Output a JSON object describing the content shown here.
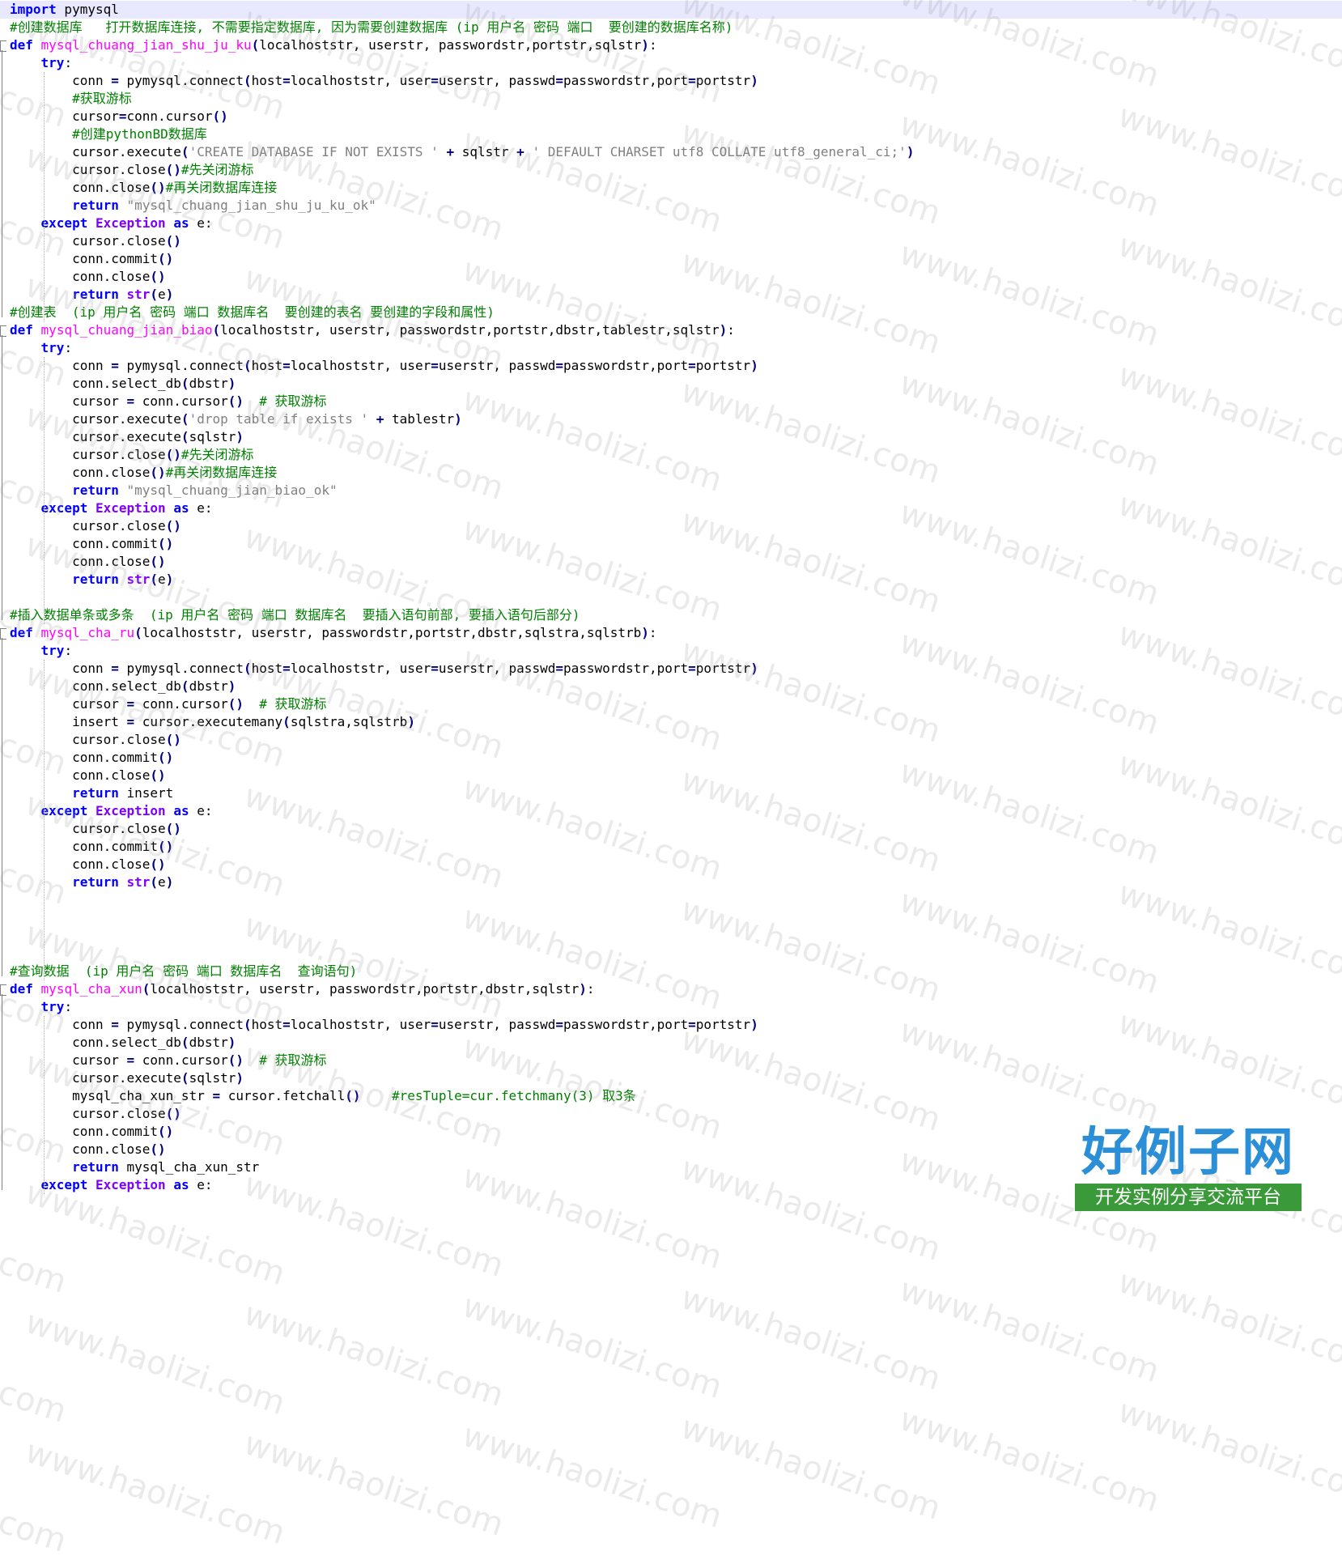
{
  "editor": {
    "lines": [
      [
        [
          "kw",
          "import"
        ],
        [
          "id",
          " pymysql"
        ]
      ],
      [
        [
          "cm",
          "#创建数据库   打开数据库连接, 不需要指定数据库, 因为需要创建数据库 (ip 用户名 密码 端口  要创建的数据库名称)"
        ]
      ],
      [
        [
          "kw",
          "def"
        ],
        [
          "id",
          " "
        ],
        [
          "fn",
          "mysql_chuang_jian_shu_ju_ku"
        ],
        [
          "op",
          "("
        ],
        [
          "id",
          "localhoststr, userstr, passwordstr,portstr,sqlstr"
        ],
        [
          "op",
          ")"
        ],
        [
          "id",
          ":"
        ]
      ],
      [
        [
          "id",
          "    "
        ],
        [
          "kw",
          "try"
        ],
        [
          "id",
          ":"
        ]
      ],
      [
        [
          "id",
          "        conn "
        ],
        [
          "op",
          "="
        ],
        [
          "id",
          " pymysql.connect"
        ],
        [
          "op",
          "("
        ],
        [
          "id",
          "host"
        ],
        [
          "op",
          "="
        ],
        [
          "id",
          "localhoststr, user"
        ],
        [
          "op",
          "="
        ],
        [
          "id",
          "userstr, passwd"
        ],
        [
          "op",
          "="
        ],
        [
          "id",
          "passwordstr,port"
        ],
        [
          "op",
          "="
        ],
        [
          "id",
          "portstr"
        ],
        [
          "op",
          ")"
        ]
      ],
      [
        [
          "id",
          "        "
        ],
        [
          "cm",
          "#获取游标"
        ]
      ],
      [
        [
          "id",
          "        cursor"
        ],
        [
          "op",
          "="
        ],
        [
          "id",
          "conn.cursor"
        ],
        [
          "op",
          "()"
        ]
      ],
      [
        [
          "id",
          "        "
        ],
        [
          "cm",
          "#创建pythonBD数据库"
        ]
      ],
      [
        [
          "id",
          "        cursor.execute"
        ],
        [
          "op",
          "("
        ],
        [
          "st",
          "'CREATE DATABASE IF NOT EXISTS '"
        ],
        [
          "id",
          " "
        ],
        [
          "op",
          "+"
        ],
        [
          "id",
          " sqlstr "
        ],
        [
          "op",
          "+"
        ],
        [
          "id",
          " "
        ],
        [
          "st",
          "' DEFAULT CHARSET utf8 COLLATE utf8_general_ci;'"
        ],
        [
          "op",
          ")"
        ]
      ],
      [
        [
          "id",
          "        cursor.close"
        ],
        [
          "op",
          "()"
        ],
        [
          "cm",
          "#先关闭游标"
        ]
      ],
      [
        [
          "id",
          "        conn.close"
        ],
        [
          "op",
          "()"
        ],
        [
          "cm",
          "#再关闭数据库连接"
        ]
      ],
      [
        [
          "id",
          "        "
        ],
        [
          "kw",
          "return"
        ],
        [
          "id",
          " "
        ],
        [
          "st",
          "\"mysql_chuang_jian_shu_ju_ku_ok\""
        ]
      ],
      [
        [
          "id",
          "    "
        ],
        [
          "kw",
          "except"
        ],
        [
          "id",
          " "
        ],
        [
          "cls",
          "Exception"
        ],
        [
          "id",
          " "
        ],
        [
          "kw",
          "as"
        ],
        [
          "id",
          " e:"
        ]
      ],
      [
        [
          "id",
          "        cursor.close"
        ],
        [
          "op",
          "()"
        ]
      ],
      [
        [
          "id",
          "        conn.commit"
        ],
        [
          "op",
          "()"
        ]
      ],
      [
        [
          "id",
          "        conn.close"
        ],
        [
          "op",
          "()"
        ]
      ],
      [
        [
          "id",
          "        "
        ],
        [
          "kw",
          "return"
        ],
        [
          "id",
          " "
        ],
        [
          "cls",
          "str"
        ],
        [
          "op",
          "("
        ],
        [
          "id",
          "e"
        ],
        [
          "op",
          ")"
        ]
      ],
      [
        [
          "cm",
          "#创建表  (ip 用户名 密码 端口 数据库名  要创建的表名 要创建的字段和属性)"
        ]
      ],
      [
        [
          "kw",
          "def"
        ],
        [
          "id",
          " "
        ],
        [
          "fn",
          "mysql_chuang_jian_biao"
        ],
        [
          "op",
          "("
        ],
        [
          "id",
          "localhoststr, userstr, passwordstr,portstr,dbstr,tablestr,sqlstr"
        ],
        [
          "op",
          ")"
        ],
        [
          "id",
          ":"
        ]
      ],
      [
        [
          "id",
          "    "
        ],
        [
          "kw",
          "try"
        ],
        [
          "id",
          ":"
        ]
      ],
      [
        [
          "id",
          "        conn "
        ],
        [
          "op",
          "="
        ],
        [
          "id",
          " pymysql.connect"
        ],
        [
          "op",
          "("
        ],
        [
          "id",
          "host"
        ],
        [
          "op",
          "="
        ],
        [
          "id",
          "localhoststr, user"
        ],
        [
          "op",
          "="
        ],
        [
          "id",
          "userstr, passwd"
        ],
        [
          "op",
          "="
        ],
        [
          "id",
          "passwordstr,port"
        ],
        [
          "op",
          "="
        ],
        [
          "id",
          "portstr"
        ],
        [
          "op",
          ")"
        ]
      ],
      [
        [
          "id",
          "        conn.select_db"
        ],
        [
          "op",
          "("
        ],
        [
          "id",
          "dbstr"
        ],
        [
          "op",
          ")"
        ]
      ],
      [
        [
          "id",
          "        cursor "
        ],
        [
          "op",
          "="
        ],
        [
          "id",
          " conn.cursor"
        ],
        [
          "op",
          "()"
        ],
        [
          "id",
          "  "
        ],
        [
          "cm",
          "# 获取游标"
        ]
      ],
      [
        [
          "id",
          "        cursor.execute"
        ],
        [
          "op",
          "("
        ],
        [
          "st",
          "'drop table if exists '"
        ],
        [
          "id",
          " "
        ],
        [
          "op",
          "+"
        ],
        [
          "id",
          " tablestr"
        ],
        [
          "op",
          ")"
        ]
      ],
      [
        [
          "id",
          "        cursor.execute"
        ],
        [
          "op",
          "("
        ],
        [
          "id",
          "sqlstr"
        ],
        [
          "op",
          ")"
        ]
      ],
      [
        [
          "id",
          "        cursor.close"
        ],
        [
          "op",
          "()"
        ],
        [
          "cm",
          "#先关闭游标"
        ]
      ],
      [
        [
          "id",
          "        conn.close"
        ],
        [
          "op",
          "()"
        ],
        [
          "cm",
          "#再关闭数据库连接"
        ]
      ],
      [
        [
          "id",
          "        "
        ],
        [
          "kw",
          "return"
        ],
        [
          "id",
          " "
        ],
        [
          "st",
          "\"mysql_chuang_jian_biao_ok\""
        ]
      ],
      [
        [
          "id",
          "    "
        ],
        [
          "kw",
          "except"
        ],
        [
          "id",
          " "
        ],
        [
          "cls",
          "Exception"
        ],
        [
          "id",
          " "
        ],
        [
          "kw",
          "as"
        ],
        [
          "id",
          " e:"
        ]
      ],
      [
        [
          "id",
          "        cursor.close"
        ],
        [
          "op",
          "()"
        ]
      ],
      [
        [
          "id",
          "        conn.commit"
        ],
        [
          "op",
          "()"
        ]
      ],
      [
        [
          "id",
          "        conn.close"
        ],
        [
          "op",
          "()"
        ]
      ],
      [
        [
          "id",
          "        "
        ],
        [
          "kw",
          "return"
        ],
        [
          "id",
          " "
        ],
        [
          "cls",
          "str"
        ],
        [
          "op",
          "("
        ],
        [
          "id",
          "e"
        ],
        [
          "op",
          ")"
        ]
      ],
      [],
      [
        [
          "cm",
          "#插入数据单条或多条  (ip 用户名 密码 端口 数据库名  要插入语句前部, 要插入语句后部分)"
        ]
      ],
      [
        [
          "kw",
          "def"
        ],
        [
          "id",
          " "
        ],
        [
          "fn",
          "mysql_cha_ru"
        ],
        [
          "op",
          "("
        ],
        [
          "id",
          "localhoststr, userstr, passwordstr,portstr,dbstr,sqlstra,sqlstrb"
        ],
        [
          "op",
          ")"
        ],
        [
          "id",
          ":"
        ]
      ],
      [
        [
          "id",
          "    "
        ],
        [
          "kw",
          "try"
        ],
        [
          "id",
          ":"
        ]
      ],
      [
        [
          "id",
          "        conn "
        ],
        [
          "op",
          "="
        ],
        [
          "id",
          " pymysql.connect"
        ],
        [
          "op",
          "("
        ],
        [
          "id",
          "host"
        ],
        [
          "op",
          "="
        ],
        [
          "id",
          "localhoststr, user"
        ],
        [
          "op",
          "="
        ],
        [
          "id",
          "userstr, passwd"
        ],
        [
          "op",
          "="
        ],
        [
          "id",
          "passwordstr,port"
        ],
        [
          "op",
          "="
        ],
        [
          "id",
          "portstr"
        ],
        [
          "op",
          ")"
        ]
      ],
      [
        [
          "id",
          "        conn.select_db"
        ],
        [
          "op",
          "("
        ],
        [
          "id",
          "dbstr"
        ],
        [
          "op",
          ")"
        ]
      ],
      [
        [
          "id",
          "        cursor "
        ],
        [
          "op",
          "="
        ],
        [
          "id",
          " conn.cursor"
        ],
        [
          "op",
          "()"
        ],
        [
          "id",
          "  "
        ],
        [
          "cm",
          "# 获取游标"
        ]
      ],
      [
        [
          "id",
          "        insert "
        ],
        [
          "op",
          "="
        ],
        [
          "id",
          " cursor.executemany"
        ],
        [
          "op",
          "("
        ],
        [
          "id",
          "sqlstra,sqlstrb"
        ],
        [
          "op",
          ")"
        ]
      ],
      [
        [
          "id",
          "        cursor.close"
        ],
        [
          "op",
          "()"
        ]
      ],
      [
        [
          "id",
          "        conn.commit"
        ],
        [
          "op",
          "()"
        ]
      ],
      [
        [
          "id",
          "        conn.close"
        ],
        [
          "op",
          "()"
        ]
      ],
      [
        [
          "id",
          "        "
        ],
        [
          "kw",
          "return"
        ],
        [
          "id",
          " insert"
        ]
      ],
      [
        [
          "id",
          "    "
        ],
        [
          "kw",
          "except"
        ],
        [
          "id",
          " "
        ],
        [
          "cls",
          "Exception"
        ],
        [
          "id",
          " "
        ],
        [
          "kw",
          "as"
        ],
        [
          "id",
          " e:"
        ]
      ],
      [
        [
          "id",
          "        cursor.close"
        ],
        [
          "op",
          "()"
        ]
      ],
      [
        [
          "id",
          "        conn.commit"
        ],
        [
          "op",
          "()"
        ]
      ],
      [
        [
          "id",
          "        conn.close"
        ],
        [
          "op",
          "()"
        ]
      ],
      [
        [
          "id",
          "        "
        ],
        [
          "kw",
          "return"
        ],
        [
          "id",
          " "
        ],
        [
          "cls",
          "str"
        ],
        [
          "op",
          "("
        ],
        [
          "id",
          "e"
        ],
        [
          "op",
          ")"
        ]
      ],
      [],
      [],
      [],
      [],
      [
        [
          "cm",
          "#查询数据  (ip 用户名 密码 端口 数据库名  查询语句)"
        ]
      ],
      [
        [
          "kw",
          "def"
        ],
        [
          "id",
          " "
        ],
        [
          "fn",
          "mysql_cha_xun"
        ],
        [
          "op",
          "("
        ],
        [
          "id",
          "localhoststr, userstr, passwordstr,portstr,dbstr,sqlstr"
        ],
        [
          "op",
          ")"
        ],
        [
          "id",
          ":"
        ]
      ],
      [
        [
          "id",
          "    "
        ],
        [
          "kw",
          "try"
        ],
        [
          "id",
          ":"
        ]
      ],
      [
        [
          "id",
          "        conn "
        ],
        [
          "op",
          "="
        ],
        [
          "id",
          " pymysql.connect"
        ],
        [
          "op",
          "("
        ],
        [
          "id",
          "host"
        ],
        [
          "op",
          "="
        ],
        [
          "id",
          "localhoststr, user"
        ],
        [
          "op",
          "="
        ],
        [
          "id",
          "userstr, passwd"
        ],
        [
          "op",
          "="
        ],
        [
          "id",
          "passwordstr,port"
        ],
        [
          "op",
          "="
        ],
        [
          "id",
          "portstr"
        ],
        [
          "op",
          ")"
        ]
      ],
      [
        [
          "id",
          "        conn.select_db"
        ],
        [
          "op",
          "("
        ],
        [
          "id",
          "dbstr"
        ],
        [
          "op",
          ")"
        ]
      ],
      [
        [
          "id",
          "        cursor "
        ],
        [
          "op",
          "="
        ],
        [
          "id",
          " conn.cursor"
        ],
        [
          "op",
          "()"
        ],
        [
          "id",
          "  "
        ],
        [
          "cm",
          "# 获取游标"
        ]
      ],
      [
        [
          "id",
          "        cursor.execute"
        ],
        [
          "op",
          "("
        ],
        [
          "id",
          "sqlstr"
        ],
        [
          "op",
          ")"
        ]
      ],
      [
        [
          "id",
          "        mysql_cha_xun_str "
        ],
        [
          "op",
          "="
        ],
        [
          "id",
          " cursor.fetchall"
        ],
        [
          "op",
          "()"
        ],
        [
          "id",
          "    "
        ],
        [
          "cm",
          "#resTuple=cur.fetchmany(3) 取3条"
        ]
      ],
      [
        [
          "id",
          "        cursor.close"
        ],
        [
          "op",
          "()"
        ]
      ],
      [
        [
          "id",
          "        conn.commit"
        ],
        [
          "op",
          "()"
        ]
      ],
      [
        [
          "id",
          "        conn.close"
        ],
        [
          "op",
          "()"
        ]
      ],
      [
        [
          "id",
          "        "
        ],
        [
          "kw",
          "return"
        ],
        [
          "id",
          " mysql_cha_xun_str"
        ]
      ],
      [
        [
          "id",
          "    "
        ],
        [
          "kw",
          "except"
        ],
        [
          "id",
          " "
        ],
        [
          "cls",
          "Exception"
        ],
        [
          "id",
          " "
        ],
        [
          "kw",
          "as"
        ],
        [
          "id",
          " e:"
        ]
      ]
    ]
  },
  "watermark": {
    "text": "www.haolizi.com"
  },
  "logo": {
    "title": "好例子网",
    "subtitle": "开发实例分享交流平台"
  },
  "colors": {
    "keyword": "#0000ff",
    "class": "#8000ff",
    "function": "#ff00ff",
    "comment": "#008000",
    "string": "#808080",
    "operator": "#000080",
    "current_line": "#e8e8ff"
  }
}
